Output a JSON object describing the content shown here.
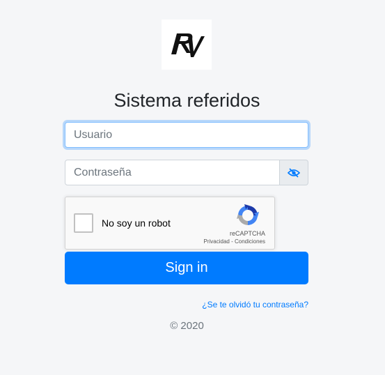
{
  "logo": {
    "text": "RV",
    "icon": "rv-logo"
  },
  "title": "Sistema referidos",
  "form": {
    "username_placeholder": "Usuario",
    "username_value": "",
    "password_placeholder": "Contraseña",
    "password_value": "",
    "toggle_icon": "eye-slash-icon"
  },
  "captcha": {
    "label": "No soy un robot",
    "brand": "reCAPTCHA",
    "privacy": "Privacidad",
    "separator": " - ",
    "terms": "Condiciones",
    "checked": false
  },
  "signin_label": "Sign in",
  "forgot_label": "¿Se te olvidó tu contraseña?",
  "copyright": "© 2020",
  "colors": {
    "primary": "#007bff",
    "background": "#f5f6f8",
    "focus_border": "#80bdff"
  }
}
